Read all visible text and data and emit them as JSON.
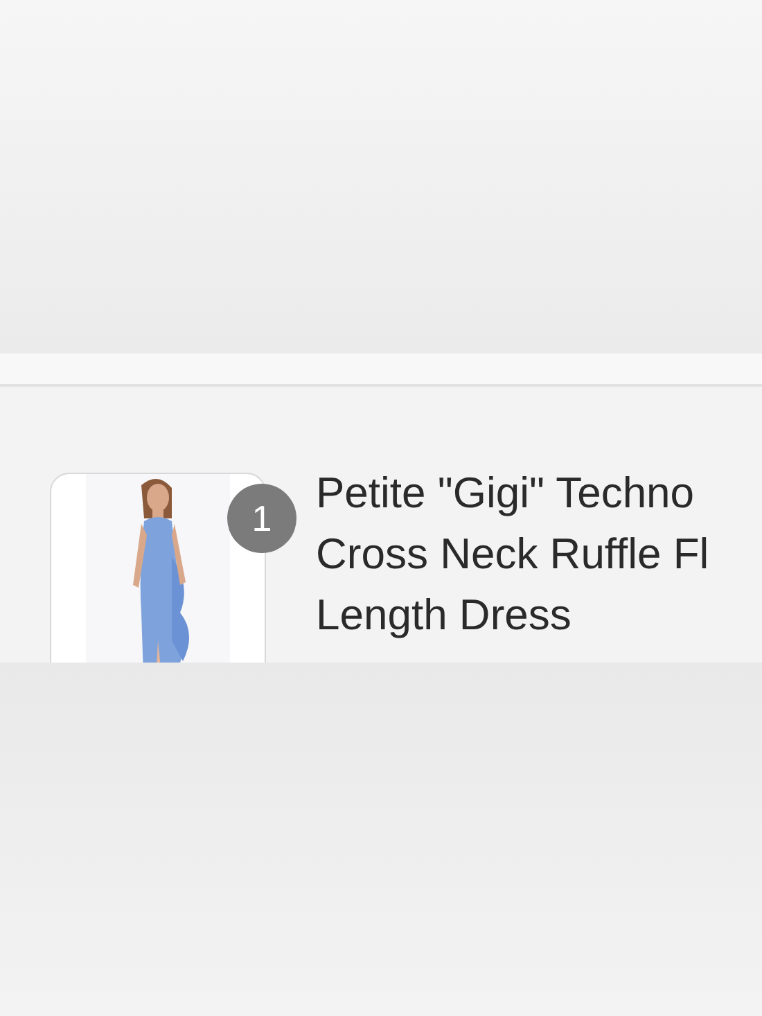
{
  "item": {
    "badge": "1",
    "title_lines": [
      "Petite \"Gigi\" Techno",
      "Cross Neck Ruffle Fl",
      "Length Dress"
    ]
  }
}
